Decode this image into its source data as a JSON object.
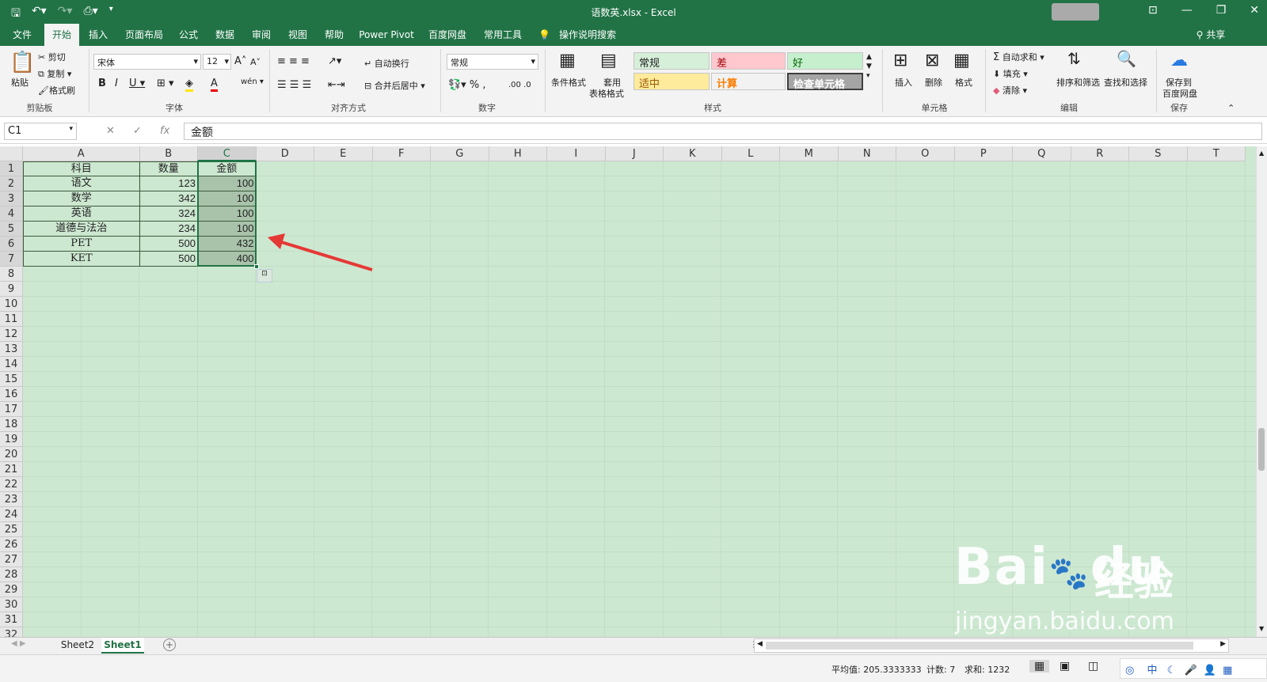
{
  "title": "语数英.xlsx  -  Excel",
  "share_label": "共享",
  "tabs": [
    "文件",
    "开始",
    "插入",
    "页面布局",
    "公式",
    "数据",
    "审阅",
    "视图",
    "帮助",
    "Power Pivot",
    "百度网盘",
    "常用工具",
    "操作说明搜索"
  ],
  "ribbon": {
    "paste": "粘贴",
    "cut": "剪切",
    "copy": "复制",
    "format_painter": "格式刷",
    "clipboard": "剪贴板",
    "font_name": "宋体",
    "font_size": "12",
    "font": "字体",
    "wrap": "自动换行",
    "merge": "合并后居中",
    "alignment": "对齐方式",
    "number_format": "常规",
    "number": "数字",
    "cond_format": "条件格式",
    "table_format_1": "套用",
    "table_format_2": "表格格式",
    "styles": "样式",
    "style_normal": "常规",
    "style_bad": "差",
    "style_good": "好",
    "style_neutral": "适中",
    "style_calc": "计算",
    "style_check": "检查单元格",
    "insert": "插入",
    "delete": "删除",
    "format": "格式",
    "cells": "单元格",
    "autosum": "自动求和",
    "fill": "填充",
    "clear": "清除",
    "sort_filter": "排序和筛选",
    "find_select": "查找和选择",
    "editing": "编辑",
    "save_baidu_1": "保存到",
    "save_baidu_2": "百度网盘",
    "save": "保存"
  },
  "formula_bar": {
    "name_box": "C1",
    "fx": "fx",
    "content": "金额"
  },
  "columns": [
    "A",
    "B",
    "C",
    "D",
    "E",
    "F",
    "G",
    "H",
    "I",
    "J",
    "K",
    "L",
    "M",
    "N",
    "O",
    "P",
    "Q",
    "R",
    "S",
    "T"
  ],
  "rows": [
    "1",
    "2",
    "3",
    "4",
    "5",
    "6",
    "7",
    "8",
    "9",
    "10",
    "11",
    "12",
    "13",
    "14",
    "15",
    "16",
    "17",
    "18",
    "19",
    "20",
    "21",
    "22",
    "23",
    "24",
    "25",
    "26",
    "27",
    "28",
    "29",
    "30",
    "31",
    "32"
  ],
  "table": {
    "headers": [
      "科目",
      "数量",
      "金额"
    ],
    "data": [
      [
        "语文",
        "123",
        "100"
      ],
      [
        "数学",
        "342",
        "100"
      ],
      [
        "英语",
        "324",
        "100"
      ],
      [
        "道德与法治",
        "234",
        "100"
      ],
      [
        "PET",
        "500",
        "432"
      ],
      [
        "KET",
        "500",
        "400"
      ]
    ]
  },
  "sheets": [
    "Sheet2",
    "Sheet1"
  ],
  "active_sheet": "Sheet1",
  "status": {
    "average": "平均值: 205.3333333",
    "count": "计数: 7",
    "sum": "求和: 1232"
  },
  "watermark": {
    "brand": "Bai",
    "brand2": "du",
    "cn": "经验",
    "url": "jingyan.baidu.com"
  },
  "colors": {
    "excel_green": "#217346",
    "sheet_bg": "#cde8d1",
    "selection": "#a9c3ab",
    "arrow": "#e53935"
  }
}
